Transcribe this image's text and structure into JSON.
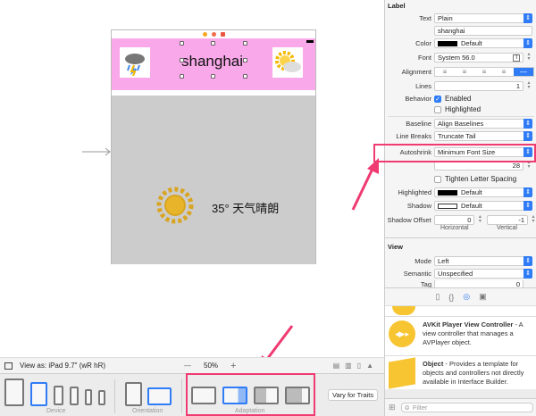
{
  "scene": {
    "city": "shanghai",
    "weather": "35° 天气晴朗"
  },
  "toolbar": {
    "view_as": "View as: iPad 9.7\" (wR hR)",
    "zoom": "50%",
    "zoom_out": "—",
    "zoom_in": "+"
  },
  "device_bar": {
    "device_label": "Device",
    "orientation_label": "Orientation",
    "adaptation_label": "Adaptation",
    "vary_button": "Vary for Traits"
  },
  "inspector": {
    "label_section": "Label",
    "text_label": "Text",
    "text_value": "Plain",
    "text_content": "shanghai",
    "color_label": "Color",
    "color_value": "Default",
    "font_label": "Font",
    "font_value": "System 56.0",
    "alignment_label": "Alignment",
    "lines_label": "Lines",
    "lines_value": "1",
    "behavior_label": "Behavior",
    "enabled": "Enabled",
    "highlighted_cb": "Highlighted",
    "baseline_label": "Baseline",
    "baseline_value": "Align Baselines",
    "linebreaks_label": "Line Breaks",
    "linebreaks_value": "Truncate Tail",
    "autoshrink_label": "Autoshrink",
    "autoshrink_value": "Minimum Font Size",
    "min_font": "28",
    "tighten": "Tighten Letter Spacing",
    "highlighted_label": "Highlighted",
    "highlighted_value": "Default",
    "shadow_label": "Shadow",
    "shadow_value": "Default",
    "shadow_offset_label": "Shadow Offset",
    "offset_h": "0",
    "offset_v": "-1",
    "horizontal": "Horizontal",
    "vertical": "Vertical",
    "view_section": "View",
    "mode_label": "Mode",
    "mode_value": "Left",
    "semantic_label": "Semantic",
    "semantic_value": "Unspecified",
    "tag_label": "Tag",
    "tag_value": "0"
  },
  "library": {
    "items": [
      {
        "title": "AVKit Player View Controller",
        "desc": " - A view controller that manages a AVPlayer object."
      },
      {
        "title": "Object",
        "desc": " - Provides a template for objects and controllers not directly available in Interface Builder."
      }
    ],
    "filter_placeholder": "Filter"
  },
  "colors": {
    "accent": "#2f7cf6",
    "annotation": "#ef3b72",
    "pink": "#f9a9e9"
  }
}
